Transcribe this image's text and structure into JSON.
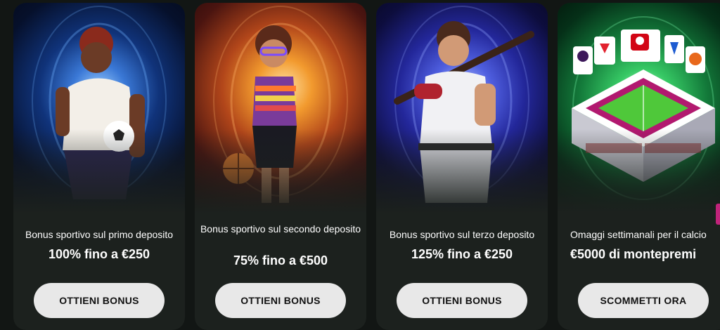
{
  "promotions": [
    {
      "title": "Bonus sportivo sul primo deposito",
      "amount": "100% fino a €250",
      "button_label": "OTTIENI BONUS",
      "illustration": "soccer-player-illustration"
    },
    {
      "title": "Bonus sportivo sul secondo deposito",
      "amount": "75% fino a €500",
      "button_label": "OTTIENI BONUS",
      "illustration": "basketball-player-illustration"
    },
    {
      "title": "Bonus sportivo sul terzo deposito",
      "amount": "125% fino a €250",
      "button_label": "OTTIENI BONUS",
      "illustration": "baseball-player-illustration"
    },
    {
      "title": "Omaggi settimanali per il calcio",
      "amount": "€5000 di montepremi",
      "button_label": "SCOMMETTI ORA",
      "illustration": "football-stadium-illustration",
      "league_logos": [
        "Premier League",
        "LALIGA",
        "BUNDESLIGA",
        "Serie A",
        "Ligue 1"
      ]
    }
  ],
  "colors": {
    "page_background": "#121614",
    "card_background": "#1c211e",
    "button_background": "#e8e8e8",
    "button_text": "#111111",
    "text": "#ffffff"
  }
}
